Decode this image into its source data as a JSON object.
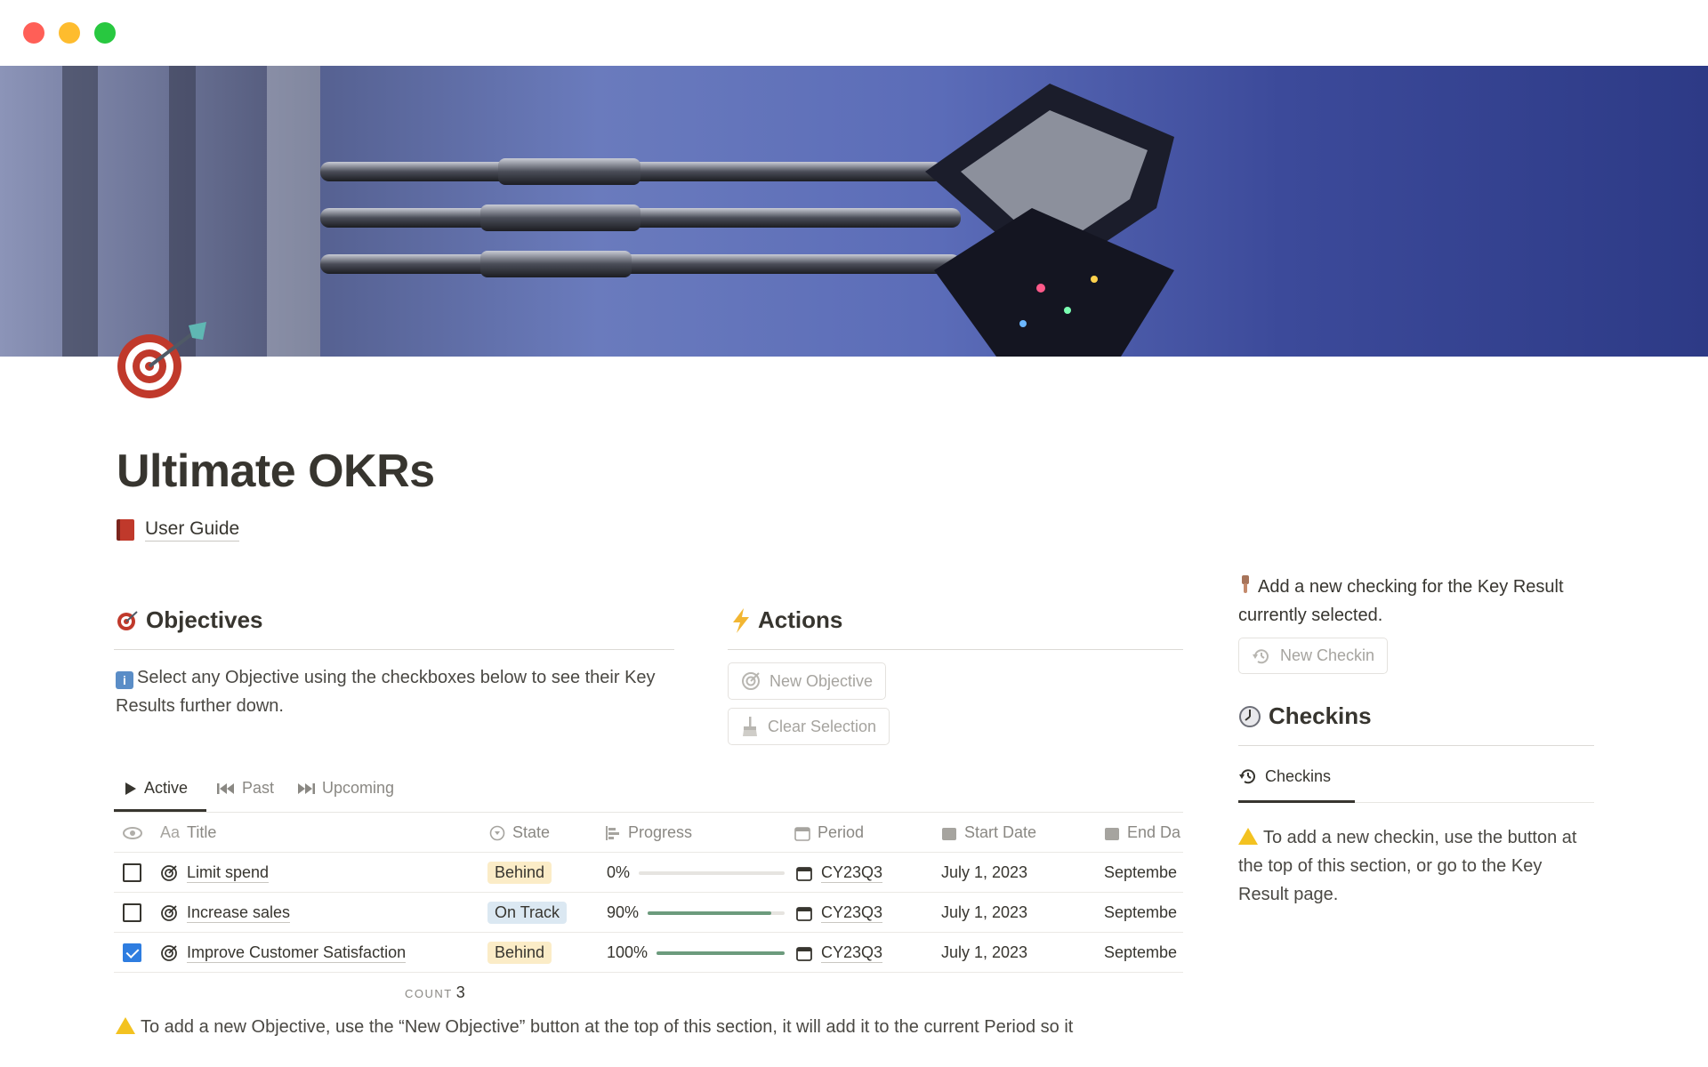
{
  "window": {
    "controls": [
      "close",
      "minimize",
      "maximize"
    ]
  },
  "page": {
    "title": "Ultimate OKRs",
    "icon": "dart-target-icon"
  },
  "links": {
    "user_guide": "User Guide"
  },
  "objectives": {
    "heading": "Objectives",
    "callout": "Select any Objective using the checkboxes below to see their Key Results further down.",
    "tabs": [
      {
        "label": "Active",
        "icon": "play-icon",
        "active": true
      },
      {
        "label": "Past",
        "icon": "skip-back-icon",
        "active": false
      },
      {
        "label": "Upcoming",
        "icon": "skip-forward-icon",
        "active": false
      }
    ],
    "columns": {
      "title_prefix": "Aa",
      "title": "Title",
      "state": "State",
      "progress": "Progress",
      "period": "Period",
      "start_date": "Start Date",
      "end_date": "End Da"
    },
    "rows": [
      {
        "checked": false,
        "title": "Limit spend",
        "state": "Behind",
        "state_color": "#fbecc7",
        "progress_label": "0%",
        "progress": 0,
        "period": "CY23Q3",
        "start": "July 1, 2023",
        "end": "Septembe"
      },
      {
        "checked": false,
        "title": "Increase sales",
        "state": "On Track",
        "state_color": "#dbe8f2",
        "progress_label": "90%",
        "progress": 0.9,
        "period": "CY23Q3",
        "start": "July 1, 2023",
        "end": "Septembe"
      },
      {
        "checked": true,
        "title": "Improve Customer Satisfaction",
        "state": "Behind",
        "state_color": "#fbecc7",
        "progress_label": "100%",
        "progress": 1.0,
        "period": "CY23Q3",
        "start": "July 1, 2023",
        "end": "Septembe"
      }
    ],
    "count_label": "COUNT",
    "count_value": "3",
    "note": "To add a new Objective, use the “New Objective” button at the top of this section, it will add it to the current Period so it"
  },
  "actions": {
    "heading": "Actions",
    "buttons": {
      "new_objective": "New Objective",
      "clear_selection": "Clear Selection"
    }
  },
  "checkins": {
    "hint": "Add a new checking for the Key Result currently selected.",
    "new_checkin": "New Checkin",
    "heading": "Checkins",
    "tab_label": "Checkins",
    "note": "To add a new checkin, use the button at the top of this section, or go to the Key Result page."
  },
  "colors": {
    "accent_blue": "#2e7de0",
    "progress_green": "#6c9b7d",
    "behind_bg": "#fbecc7",
    "on_track_bg": "#dbe8f2"
  }
}
